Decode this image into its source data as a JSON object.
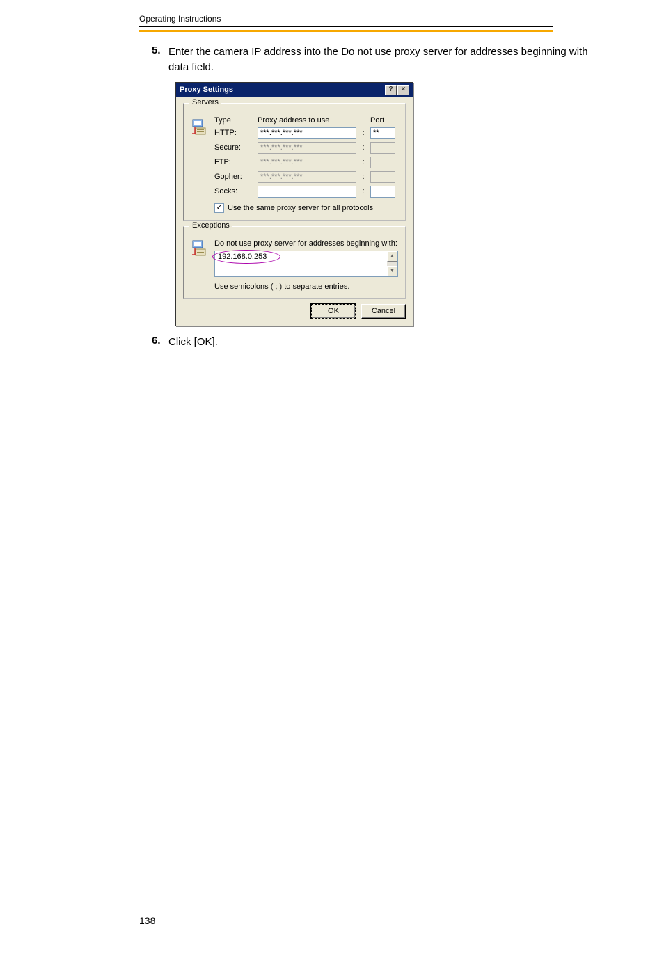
{
  "doc_header": "Operating Instructions",
  "step5": {
    "num": "5.",
    "text": "Enter the camera IP address into the Do not use proxy server for addresses beginning with data field."
  },
  "step6": {
    "num": "6.",
    "text": "Click [OK]."
  },
  "dialog": {
    "title": "Proxy Settings",
    "help_glyph": "?",
    "close_glyph": "×",
    "servers": {
      "legend": "Servers",
      "h_type": "Type",
      "h_addr": "Proxy address to use",
      "h_port": "Port",
      "rows": {
        "http": {
          "label": "HTTP:",
          "addr": "***.***.***.***",
          "port": "**"
        },
        "secure": {
          "label": "Secure:",
          "addr": "***.***.***.***",
          "port": ""
        },
        "ftp": {
          "label": "FTP:",
          "addr": "***.***.***.***",
          "port": ""
        },
        "gopher": {
          "label": "Gopher:",
          "addr": "***.***.***.***",
          "port": ""
        },
        "socks": {
          "label": "Socks:",
          "addr": "",
          "port": ""
        }
      },
      "chk_glyph": "✓",
      "chk_label": "Use the same proxy server for all protocols"
    },
    "exceptions": {
      "legend": "Exceptions",
      "line1": "Do not use proxy server for addresses beginning with:",
      "value": "192.168.0.253",
      "semicolon_note": "Use semicolons ( ; ) to separate entries."
    },
    "buttons": {
      "ok": "OK",
      "cancel": "Cancel"
    }
  },
  "page_number": "138"
}
